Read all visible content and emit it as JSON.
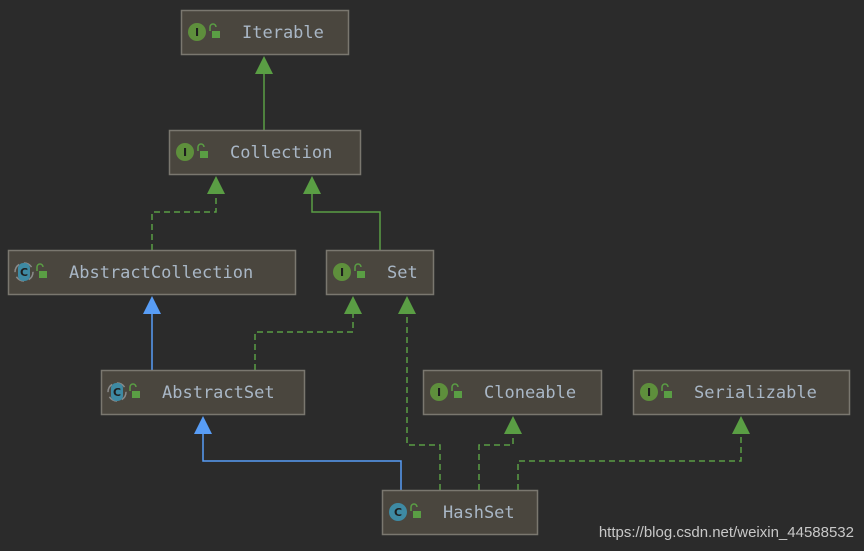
{
  "colors": {
    "background": "#2b2b2b",
    "node_fill": "#4a463e",
    "node_border": "#7a776f",
    "interface_icon": "#5e8f3c",
    "class_icon": "#3e8aa3",
    "implements": "#5a9e44",
    "extends_interface": "#5a9e44",
    "extends_class": "#589df6",
    "text": "#a9b7c6"
  },
  "nodes": [
    {
      "id": "iterable",
      "name": "Iterable",
      "kind": "interface",
      "icon": "interface-icon",
      "letter": "I"
    },
    {
      "id": "collection",
      "name": "Collection",
      "kind": "interface",
      "icon": "interface-icon",
      "letter": "I"
    },
    {
      "id": "abstractcollection",
      "name": "AbstractCollection",
      "kind": "abstract-class",
      "icon": "abstract-class-icon",
      "letter": "C"
    },
    {
      "id": "set",
      "name": "Set",
      "kind": "interface",
      "icon": "interface-icon",
      "letter": "I"
    },
    {
      "id": "abstractset",
      "name": "AbstractSet",
      "kind": "abstract-class",
      "icon": "abstract-class-icon",
      "letter": "C"
    },
    {
      "id": "cloneable",
      "name": "Cloneable",
      "kind": "interface",
      "icon": "interface-icon",
      "letter": "I"
    },
    {
      "id": "serializable",
      "name": "Serializable",
      "kind": "interface",
      "icon": "interface-icon",
      "letter": "I"
    },
    {
      "id": "hashset",
      "name": "HashSet",
      "kind": "class",
      "icon": "class-icon",
      "letter": "C"
    }
  ],
  "edges": [
    {
      "from": "collection",
      "to": "iterable",
      "type": "extends_interface"
    },
    {
      "from": "abstractcollection",
      "to": "collection",
      "type": "implements"
    },
    {
      "from": "set",
      "to": "collection",
      "type": "extends_interface"
    },
    {
      "from": "abstractset",
      "to": "abstractcollection",
      "type": "extends_class"
    },
    {
      "from": "abstractset",
      "to": "set",
      "type": "implements"
    },
    {
      "from": "hashset",
      "to": "abstractset",
      "type": "extends_class"
    },
    {
      "from": "hashset",
      "to": "set",
      "type": "implements"
    },
    {
      "from": "hashset",
      "to": "cloneable",
      "type": "implements"
    },
    {
      "from": "hashset",
      "to": "serializable",
      "type": "implements"
    }
  ],
  "watermark": "https://blog.csdn.net/weixin_44588532"
}
